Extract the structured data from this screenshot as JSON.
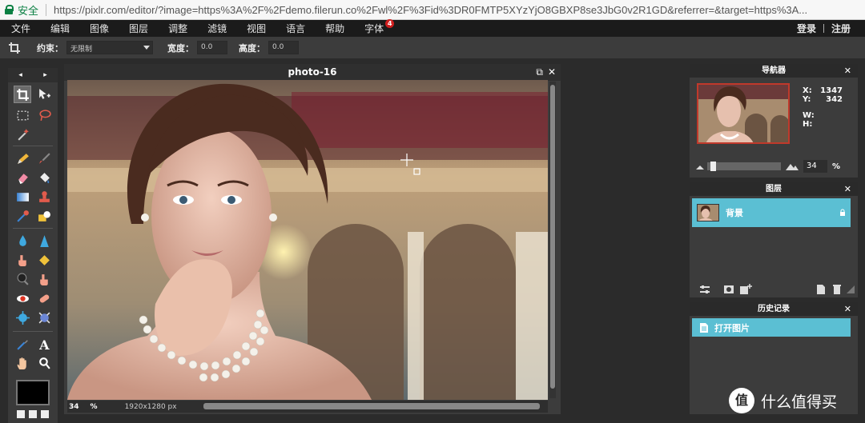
{
  "browser": {
    "secure_label": "安全",
    "url": "https://pixlr.com/editor/?image=https%3A%2F%2Fdemo.filerun.co%2Fwl%2F%3Fid%3DR0FMTP5XYzYjO8GBXP8se3JbG0v2R1GD&referrer=&target=https%3A..."
  },
  "menubar": {
    "items": [
      "文件",
      "编辑",
      "图像",
      "图层",
      "调整",
      "滤镜",
      "视图",
      "语言",
      "帮助",
      "字体"
    ],
    "font_badge": "4",
    "login": "登录",
    "register": "注册"
  },
  "options": {
    "constraint_label": "约束：",
    "constraint_value": "无限制",
    "width_label": "宽度：",
    "width_value": "0.0",
    "height_label": "高度：",
    "height_value": "0.0"
  },
  "toolbox": {
    "prev": "◂",
    "next": "▸"
  },
  "canvas": {
    "title": "photo-16",
    "restore_glyph": "⧉",
    "close_glyph": "✕",
    "zoom": "34",
    "zoom_unit": "%",
    "dimensions": "1920x1280 px"
  },
  "navigator": {
    "title": "导航器",
    "close": "✕",
    "x_label": "X:",
    "x_value": "1347",
    "y_label": "Y:",
    "y_value": "342",
    "w_label": "W:",
    "h_label": "H:",
    "zoom_value": "34",
    "zoom_unit": "%",
    "zoom_fraction": 0.05
  },
  "layers": {
    "title": "图层",
    "close": "✕",
    "items": [
      {
        "name": "背景",
        "locked": true
      }
    ]
  },
  "history": {
    "title": "历史记录",
    "close": "✕",
    "items": [
      {
        "name": "打开图片"
      }
    ]
  },
  "watermark": {
    "logo": "值",
    "text": "什么值得买"
  },
  "colors": {
    "accent": "#5bbfd3",
    "foreground": "#000000",
    "secure_green": "#0b8043"
  }
}
